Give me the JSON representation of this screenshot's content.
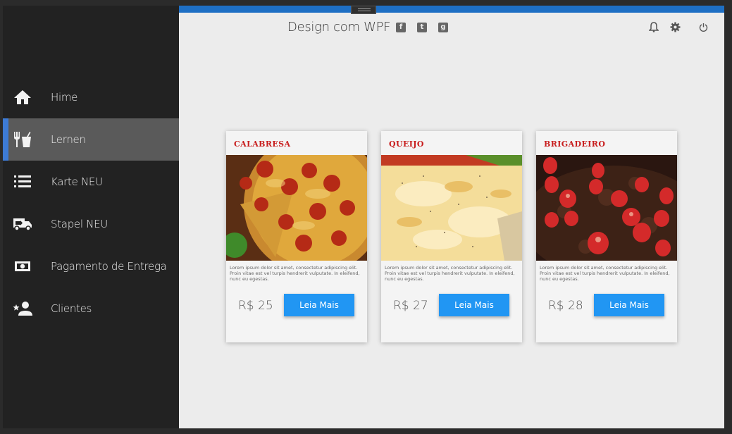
{
  "header": {
    "title": "Design com WPF",
    "social": [
      {
        "icon": "facebook-icon",
        "glyph": "f"
      },
      {
        "icon": "twitter-icon",
        "glyph": "t"
      },
      {
        "icon": "github-icon",
        "glyph": "g"
      }
    ],
    "tools": [
      "bell-icon",
      "gear-icon",
      "power-icon"
    ],
    "accent_color": "#1e6fc4"
  },
  "sidebar": {
    "items": [
      {
        "label": "Hime",
        "icon": "home-icon"
      },
      {
        "label": "Lernen",
        "icon": "food-icon",
        "active": true
      },
      {
        "label": "Karte NEU",
        "icon": "list-icon"
      },
      {
        "label": "Stapel NEU",
        "icon": "truck-icon"
      },
      {
        "label": "Pagamento de Entrega",
        "icon": "cash-icon"
      },
      {
        "label": "Clientes",
        "icon": "account-star-icon"
      }
    ],
    "active_color": "#3d7bd6"
  },
  "cards": [
    {
      "title": "Calabresa",
      "description": "Lorem ipsum dolor sit amet, consectetur adipiscing elit. Proin vitae est vel turpis hendrerit vulputate. In eleifend, nunc eu egestas.",
      "price": "R$ 25",
      "button": "Leia Mais"
    },
    {
      "title": "Queijo",
      "description": "Lorem ipsum dolor sit amet, consectetur adipiscing elit. Proin vitae est vel turpis hendrerit vulputate. In eleifend, nunc eu egestas.",
      "price": "R$ 27",
      "button": "Leia Mais"
    },
    {
      "title": "Brigadeiro",
      "description": "Lorem ipsum dolor sit amet, consectetur adipiscing elit. Proin vitae est vel turpis hendrerit vulputate. In eleifend, nunc eu egestas.",
      "price": "R$ 28",
      "button": "Leia Mais"
    }
  ],
  "colors": {
    "title_red": "#c81e1e",
    "button_blue": "#2196f3"
  }
}
